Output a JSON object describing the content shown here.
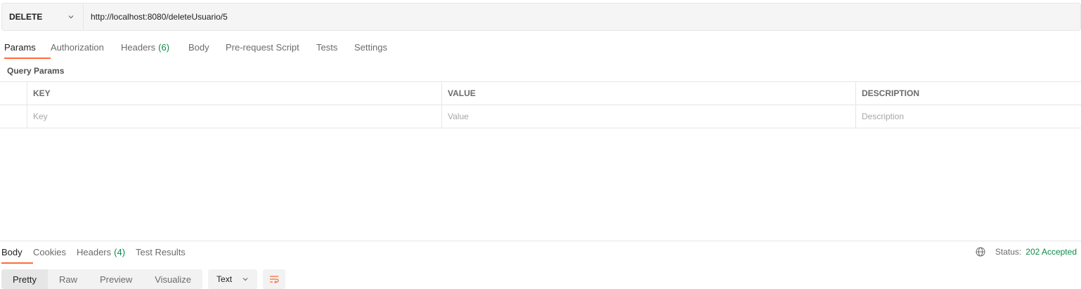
{
  "request": {
    "method": "DELETE",
    "url": "http://localhost:8080/deleteUsuario/5"
  },
  "request_tabs": [
    {
      "label": "Params",
      "count": ""
    },
    {
      "label": "Authorization",
      "count": ""
    },
    {
      "label": "Headers",
      "count": "(6)"
    },
    {
      "label": "Body",
      "count": ""
    },
    {
      "label": "Pre-request Script",
      "count": ""
    },
    {
      "label": "Tests",
      "count": ""
    },
    {
      "label": "Settings",
      "count": ""
    }
  ],
  "query_params": {
    "title": "Query Params",
    "columns": {
      "key": "KEY",
      "value": "VALUE",
      "description": "DESCRIPTION"
    },
    "placeholders": {
      "key": "Key",
      "value": "Value",
      "description": "Description"
    }
  },
  "response_tabs": [
    {
      "label": "Body",
      "count": ""
    },
    {
      "label": "Cookies",
      "count": ""
    },
    {
      "label": "Headers",
      "count": "(4)"
    },
    {
      "label": "Test Results",
      "count": ""
    }
  ],
  "status": {
    "label": "Status:",
    "value": "202 Accepted"
  },
  "view_modes": [
    "Pretty",
    "Raw",
    "Preview",
    "Visualize"
  ],
  "format": "Text",
  "icons": {
    "method_dropdown": "chevron-down-icon",
    "globe": "globe-icon",
    "format_dropdown": "chevron-down-icon",
    "wrap": "wrap-lines-icon"
  },
  "colors": {
    "accent": "#ff6c37",
    "count_green": "#0b8a4a",
    "status_green": "#0b8a4a"
  }
}
